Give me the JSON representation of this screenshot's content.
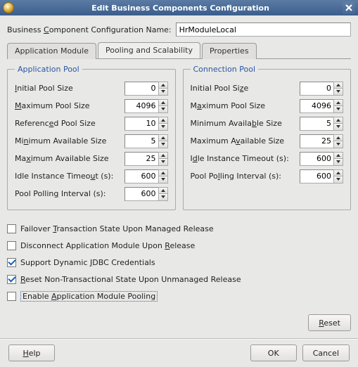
{
  "window": {
    "title": "Edit Business Components Configuration"
  },
  "config_name": {
    "label_pre": "Business ",
    "label_u": "C",
    "label_post": "omponent Configuration Name:",
    "value": "HrModuleLocal"
  },
  "tabs": {
    "t0": "Application Module",
    "t1": "Pooling and Scalability",
    "t2": "Properties"
  },
  "app_pool": {
    "legend": "Application Pool",
    "rows": {
      "initial": {
        "pre": "",
        "u": "I",
        "post": "nitial Pool Size",
        "value": "0"
      },
      "max": {
        "pre": "",
        "u": "M",
        "post": "aximum Pool Size",
        "value": "4096"
      },
      "ref": {
        "pre": "Referenc",
        "u": "e",
        "post": "d Pool Size",
        "value": "10"
      },
      "minav": {
        "pre": "Mi",
        "u": "n",
        "post": "imum Available Size",
        "value": "5"
      },
      "maxav": {
        "pre": "Ma",
        "u": "x",
        "post": "imum Available Size",
        "value": "25"
      },
      "idle": {
        "pre": "Idle Instance Timeo",
        "u": "u",
        "post": "t (s):",
        "value": "600"
      },
      "poll": {
        "pre": "Pool Pollin",
        "u": "g",
        "post": " Interval (s):",
        "value": "600"
      }
    }
  },
  "conn_pool": {
    "legend": "Connection Pool",
    "rows": {
      "initial": {
        "pre": "Initial Pool Si",
        "u": "z",
        "post": "e",
        "value": "0"
      },
      "max": {
        "pre": "M",
        "u": "a",
        "post": "ximum Pool Size",
        "value": "4096"
      },
      "minav": {
        "pre": "Minimum Availa",
        "u": "b",
        "post": "le Size",
        "value": "5"
      },
      "maxav": {
        "pre": "Maximum A",
        "u": "v",
        "post": "ailable Size",
        "value": "25"
      },
      "idle": {
        "pre": "I",
        "u": "d",
        "post": "le Instance Timeout (s):",
        "value": "600"
      },
      "poll": {
        "pre": "Pool Po",
        "u": "l",
        "post": "ling Interval (s):",
        "value": "600"
      }
    }
  },
  "checks": {
    "failover": {
      "pre": "Failover ",
      "u": "T",
      "post": "ransaction State Upon Managed Release",
      "checked": false
    },
    "disconnect": {
      "pre": "Disconnect Application Module Upon ",
      "u": "R",
      "post": "elease",
      "checked": false
    },
    "jdbc": {
      "pre": "Support Dynamic ",
      "u": "J",
      "post": "DBC Credentials",
      "checked": true
    },
    "reset": {
      "pre": "",
      "u": "R",
      "post": "eset Non-Transactional State Upon Unmanaged Release",
      "checked": true
    },
    "pooling": {
      "pre": "Enable ",
      "u": "A",
      "post": "pplication Module Pooling",
      "checked": false
    }
  },
  "buttons": {
    "reset_pre": "",
    "reset_u": "R",
    "reset_post": "eset",
    "help_pre": "",
    "help_u": "H",
    "help_post": "elp",
    "ok": "OK",
    "cancel": "Cancel"
  }
}
